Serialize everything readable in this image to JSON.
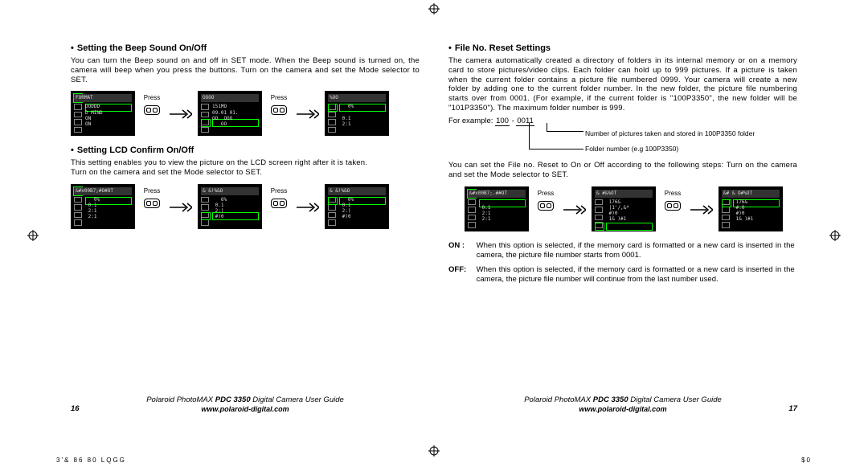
{
  "left": {
    "section1": {
      "title": "Setting the Beep Sound On/Off",
      "body": "You can turn the Beep sound on and off in SET mode. When the Beep sound is turned on, the camera will beep when you press the buttons. Turn on the camera and set the Mode selector to SET.",
      "press": "Press",
      "screens": [
        {
          "title": "FORMAT",
          "lines": "DODDD\nD MIND\nON\nON"
        },
        {
          "title": "OOOO",
          "lines": "151MO\n09.01 01.\nOO  OOO\n   OO"
        },
        {
          "title": "%OO",
          "lines": "   0%\n\n 0.1\n 2:1"
        }
      ]
    },
    "section2": {
      "title": "Setting LCD Confirm On/Off",
      "body": "This setting enables you to view the picture on the LCD screen right after it is taken.\nTurn on the camera and set the Mode selector to SET.",
      "press": "Press",
      "screens": [
        {
          "title": "&#x00B7;#O#OT",
          "lines": "   0%\n 0.1\n 2:1\n 2:1"
        },
        {
          "title": "&  &!%&O",
          "lines": "   6%\n 0.1\n 2:)\n #)0"
        },
        {
          "title": "&  &!%&O",
          "lines": "   0%\n 0.1\n 2:)\n #)0"
        }
      ]
    },
    "footer": {
      "pagenum": "16",
      "title_a": "Polaroid PhotoMAX",
      "title_b": "PDC 3350",
      "title_c": "Digital Camera User Guide",
      "url": "www.polaroid-digital.com"
    }
  },
  "right": {
    "section": {
      "title": "File No. Reset Settings",
      "body": "The camera automatically created a directory of folders in its internal memory or on a memory card to store pictures/video clips. Each folder can hold up to 999 pictures. If a picture is taken when the current folder contains a picture file numbered 0999. Your camera will create a new folder by adding one to the current folder number. In the new folder, the picture file numbering starts over from 0001. (For example, if the current folder is \"100P3350\", the new folder will be \"101P3350\"). The maximum folder number is 999.",
      "example_prefix": "For example: ",
      "example_a": "100",
      "example_dash": "-",
      "example_b": "0011",
      "callout1": "Number of pictures taken and stored in 100P3350 folder",
      "callout2": "Folder number (e.g 100P3350)",
      "body2": "You can set the File no. Reset to On or Off according to the following steps: Turn on the camera and set the Mode selector to SET.",
      "press": "Press",
      "screens": [
        {
          "title": "&#x00B7;.##OT",
          "lines": "\n 0.1\n 2:1\n 2:1"
        },
        {
          "title": "&   #&%OT",
          "lines": " 176&\n |1'/,&*\n #)0\n 1& )#1"
        },
        {
          "title": "&#  &  O#%OT",
          "lines": " 176&\n #.0\n #)0\n 1& )#1"
        }
      ],
      "on_label": "ON :",
      "on_text": "When this option is selected, if the memory card is formatted or a new card is inserted in the camera, the picture file number starts from 0001.",
      "off_label": "OFF:",
      "off_text": "When this option is selected, if the memory card is formatted or a new card is inserted in the camera, the picture file number will continue from the last number used."
    },
    "footer": {
      "pagenum": "17",
      "title_a": "Polaroid PhotoMAX",
      "title_b": "PDC 3350",
      "title_c": "Digital Camera User Guide",
      "url": "www.polaroid-digital.com"
    }
  },
  "bottom": {
    "left": "3'&    86 80 LQGG",
    "right": "$0"
  }
}
